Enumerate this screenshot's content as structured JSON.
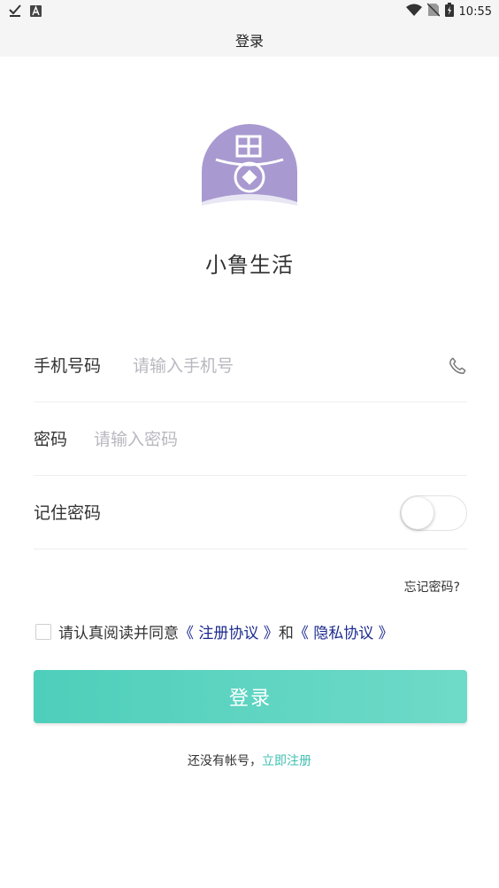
{
  "status_bar": {
    "time": "10:55",
    "left_icons": [
      "check-download-icon",
      "a-notification-icon"
    ],
    "right_icons": [
      "wifi-icon",
      "no-sim-icon",
      "battery-charging-icon"
    ]
  },
  "header": {
    "title": "登录"
  },
  "logo": {
    "icon": "app-logo-icon",
    "bg_color": "#a89ad0"
  },
  "app_name": "小鲁生活",
  "form": {
    "phone_label": "手机号码",
    "phone_placeholder": "请输入手机号",
    "phone_value": "",
    "password_label": "密码",
    "password_placeholder": "请输入密码",
    "password_value": "",
    "remember_label": "记住密码",
    "remember_checked": false
  },
  "forgot_password": "忘记密码?",
  "agreement": {
    "checked": false,
    "prefix": "请认真阅读并同意",
    "terms_link": "《 注册协议 》",
    "and": "和",
    "privacy_link": "《 隐私协议 》"
  },
  "login_button": "登录",
  "register": {
    "prompt": "还没有帐号，",
    "link": "立即注册"
  },
  "colors": {
    "accent_start": "#4ecfbb",
    "accent_end": "#6fdac8",
    "link_blue": "#1c2a8e",
    "register_link": "#3fbfb0"
  }
}
